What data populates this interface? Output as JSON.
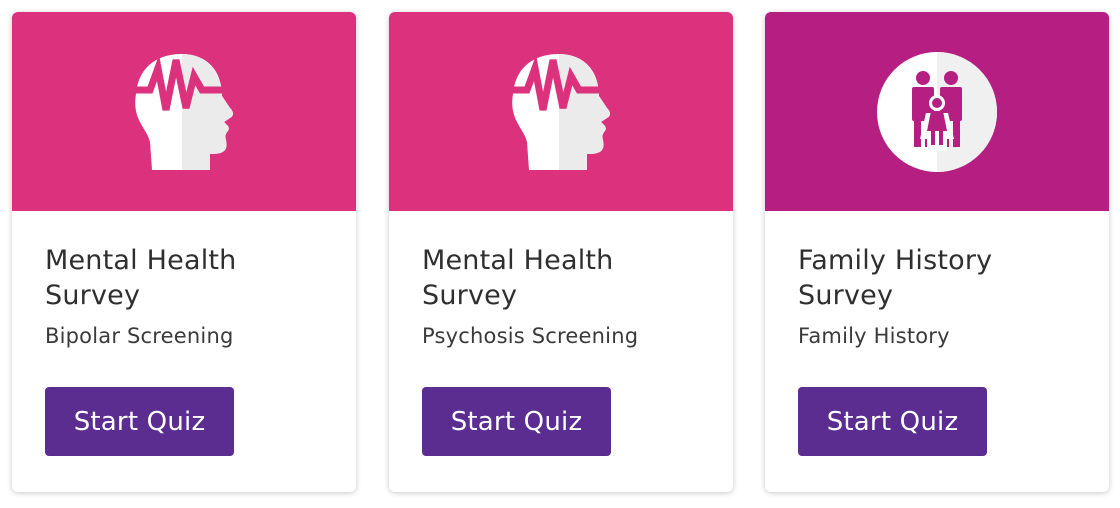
{
  "colors": {
    "banner_pink": "#dc327e",
    "banner_magenta": "#b61f82",
    "button_purple": "#5b2d91",
    "icon_white": "#ffffff",
    "icon_shade": "#ebebeb"
  },
  "cards": [
    {
      "icon": "head-brainwave-icon",
      "title_line1": "Mental Health",
      "title_line2": "Survey",
      "subtitle": "Bipolar Screening",
      "button_label": "Start Quiz"
    },
    {
      "icon": "head-brainwave-icon",
      "title_line1": "Mental Health",
      "title_line2": "Survey",
      "subtitle": "Psychosis Screening",
      "button_label": "Start Quiz"
    },
    {
      "icon": "family-icon",
      "title_line1": "Family History",
      "title_line2": "Survey",
      "subtitle": "Family History",
      "button_label": "Start Quiz"
    }
  ]
}
